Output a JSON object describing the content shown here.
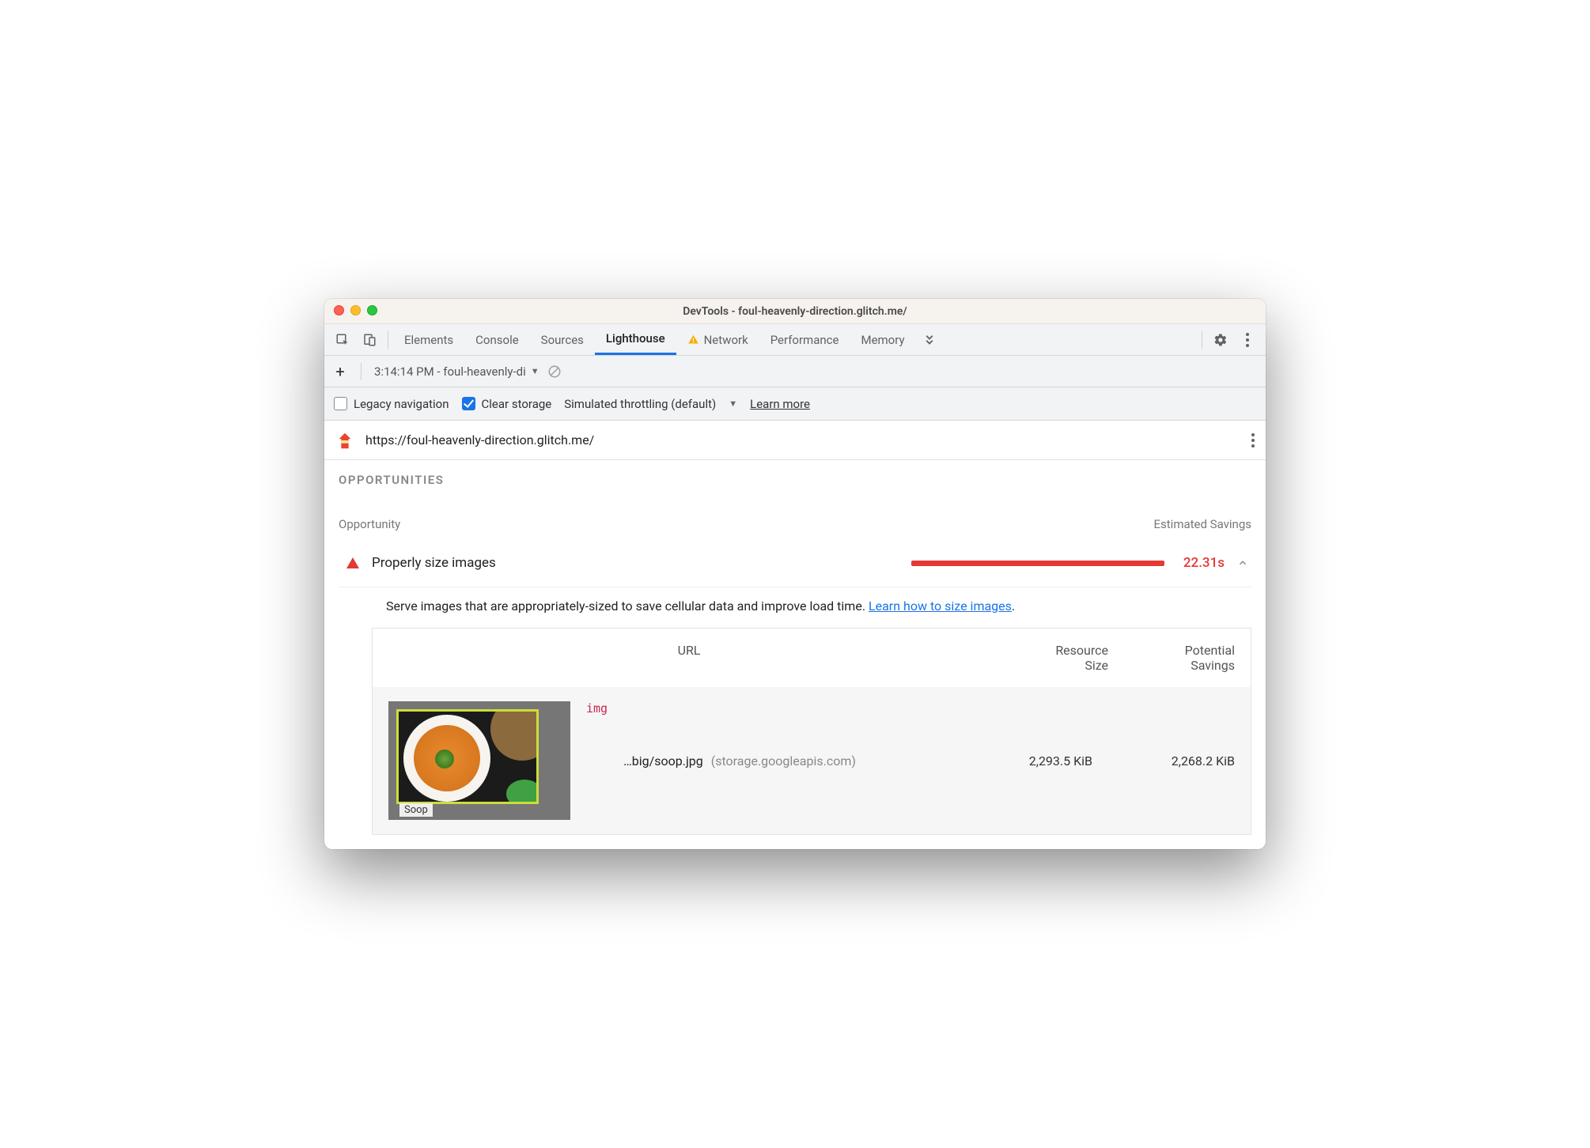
{
  "window": {
    "title": "DevTools - foul-heavenly-direction.glitch.me/"
  },
  "tabs": {
    "items": [
      "Elements",
      "Console",
      "Sources",
      "Lighthouse",
      "Network",
      "Performance",
      "Memory"
    ],
    "active": "Lighthouse",
    "network_has_warning": true
  },
  "subbar": {
    "report_label": "3:14:14 PM - foul-heavenly-di"
  },
  "options": {
    "legacy_label": "Legacy navigation",
    "legacy_checked": false,
    "clear_label": "Clear storage",
    "clear_checked": true,
    "throttle_label": "Simulated throttling (default)",
    "learn_more": "Learn more"
  },
  "urlbar": {
    "url": "https://foul-heavenly-direction.glitch.me/"
  },
  "section": {
    "title": "OPPORTUNITIES",
    "col_opportunity": "Opportunity",
    "col_savings": "Estimated Savings"
  },
  "opportunity": {
    "label": "Properly size images",
    "savings": "22.31s",
    "description": "Serve images that are appropriately-sized to save cellular data and improve load time. ",
    "link_text": "Learn how to size images"
  },
  "table": {
    "head_url": "URL",
    "head_size_1": "Resource",
    "head_size_2": "Size",
    "head_sav_1": "Potential",
    "head_sav_2": "Savings",
    "row": {
      "tag": "img",
      "caption": "Soop",
      "path": "…big/soop.jpg",
      "domain": "(storage.googleapis.com)",
      "size": "2,293.5 KiB",
      "savings": "2,268.2 KiB"
    }
  }
}
